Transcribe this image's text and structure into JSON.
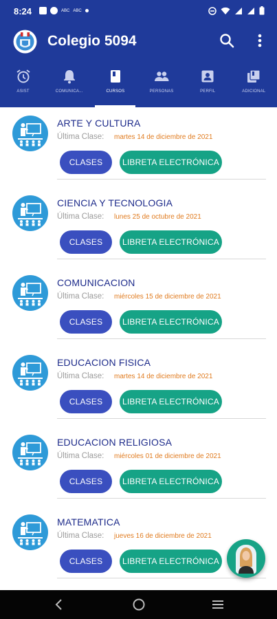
{
  "status_bar": {
    "time": "8:24",
    "left_labels": [
      "ABC",
      "ABC"
    ],
    "icons": [
      "message-icon",
      "pocket-icon",
      "do-not-disturb-icon",
      "wifi-icon",
      "signal-icon",
      "signal-icon",
      "battery-icon"
    ]
  },
  "app_bar": {
    "title": "Colegio 5094",
    "color": "#1f3a9a"
  },
  "tabs": [
    {
      "label": "ASIST",
      "icon": "alarm-clock-icon",
      "active": false
    },
    {
      "label": "COMUNICA...",
      "icon": "bell-icon",
      "active": false
    },
    {
      "label": "CURSOS",
      "icon": "book-icon",
      "active": true
    },
    {
      "label": "PERSONAS",
      "icon": "people-icon",
      "active": false
    },
    {
      "label": "PERFIL",
      "icon": "profile-card-icon",
      "active": false
    },
    {
      "label": "ADICIONAL",
      "icon": "library-icon",
      "active": false
    }
  ],
  "courses": [
    {
      "name": "ARTE Y CULTURA",
      "last_label": "Última Clase:",
      "last_date": "martes 14 de diciembre de 2021",
      "clases_label": "CLASES",
      "libreta_label": "LIBRETA ELECTRÓNICA"
    },
    {
      "name": "CIENCIA Y TECNOLOGIA",
      "last_label": "Última Clase:",
      "last_date": "lunes 25 de octubre de 2021",
      "clases_label": "CLASES",
      "libreta_label": "LIBRETA ELECTRÓNICA"
    },
    {
      "name": "COMUNICACION",
      "last_label": "Última Clase:",
      "last_date": "miércoles 15 de diciembre de 2021",
      "clases_label": "CLASES",
      "libreta_label": "LIBRETA ELECTRÓNICA"
    },
    {
      "name": "EDUCACION FISICA",
      "last_label": "Última Clase:",
      "last_date": "martes 14 de diciembre de 2021",
      "clases_label": "CLASES",
      "libreta_label": "LIBRETA ELECTRÓNICA"
    },
    {
      "name": "EDUCACION RELIGIOSA",
      "last_label": "Última Clase:",
      "last_date": "miércoles 01 de diciembre de 2021",
      "clases_label": "CLASES",
      "libreta_label": "LIBRETA ELECTRÓNICA"
    },
    {
      "name": "MATEMATICA",
      "last_label": "Última Clase:",
      "last_date": "jueves 16 de diciembre de 2021",
      "clases_label": "CLASES",
      "libreta_label": "LIBRETA ELECTRÓNICA"
    }
  ],
  "colors": {
    "primary": "#1f3a9a",
    "course_title": "#1c2a8a",
    "date": "#e07b1f",
    "clases_button": "#3a4fbf",
    "libreta_button": "#16a386",
    "fab": "#16a386"
  },
  "nav_bar": {
    "buttons": [
      "back-icon",
      "home-icon",
      "recents-icon"
    ]
  }
}
